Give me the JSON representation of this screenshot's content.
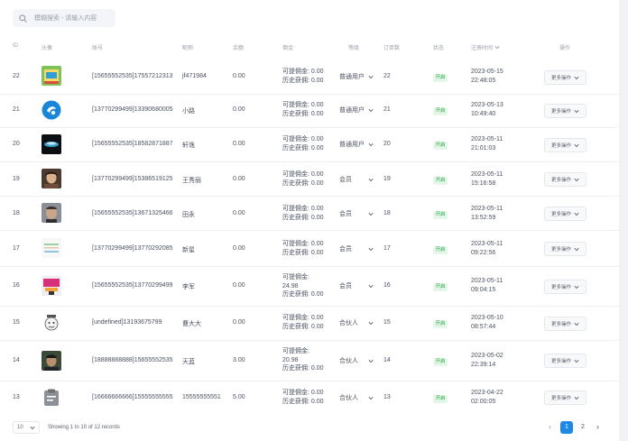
{
  "search": {
    "placeholder": "模糊搜索 - 请输入内容"
  },
  "columns": {
    "id": "ID",
    "avatar": "头像",
    "account": "账号",
    "nickname": "昵称",
    "balance": "余额",
    "commission": "佣金",
    "level": "等级",
    "orders": "订单数",
    "status": "状态",
    "register_time": "注册时间",
    "actions": "操作"
  },
  "rows": [
    {
      "id": "22",
      "account": "[15655552535]17557212313",
      "nickname": "jf471984",
      "balance": "0.00",
      "withdrawable": "可提佣金:  0.00",
      "history": "历史获佣:  0.00",
      "level": "普通用户",
      "orders": "22",
      "status": "开启",
      "date": "2023-05-15",
      "time": "22:48:05",
      "more": "更多操作"
    },
    {
      "id": "21",
      "account": "[13770299499]13390680005",
      "nickname": "小路",
      "balance": "0.00",
      "withdrawable": "可提佣金:  0.00",
      "history": "历史获佣:  0.00",
      "level": "普通用户",
      "orders": "21",
      "status": "开启",
      "date": "2023-05-13",
      "time": "10:49:40",
      "more": "更多操作"
    },
    {
      "id": "20",
      "account": "[15655552535]18582871887",
      "nickname": "轩逸",
      "balance": "0.00",
      "withdrawable": "可提佣金:  0.00",
      "history": "历史获佣:  0.00",
      "level": "普通用户",
      "orders": "20",
      "status": "开启",
      "date": "2023-05-11",
      "time": "21:01:03",
      "more": "更多操作"
    },
    {
      "id": "19",
      "account": "[13770299499]15386519125",
      "nickname": "王秀丽",
      "balance": "0.00",
      "withdrawable": "可提佣金:  0.00",
      "history": "历史获佣:  0.00",
      "level": "会员",
      "orders": "19",
      "status": "开启",
      "date": "2023-05-11",
      "time": "15:16:58",
      "more": "更多操作"
    },
    {
      "id": "18",
      "account": "[15655552535]13671325466",
      "nickname": "田永",
      "balance": "0.00",
      "withdrawable": "可提佣金:  0.00",
      "history": "历史获佣:  0.00",
      "level": "会员",
      "orders": "18",
      "status": "开启",
      "date": "2023-05-11",
      "time": "13:52:59",
      "more": "更多操作"
    },
    {
      "id": "17",
      "account": "[13770299499]13770292085",
      "nickname": "新星",
      "balance": "0.00",
      "withdrawable": "可提佣金:  0.00",
      "history": "历史获佣:  0.00",
      "level": "会员",
      "orders": "17",
      "status": "开启",
      "date": "2023-05-11",
      "time": "09:22:56",
      "more": "更多操作"
    },
    {
      "id": "16",
      "account": "[15655552535]13770299499",
      "nickname": "李军",
      "balance": "0.00",
      "withdrawable": "可提佣金:",
      "withdrawable_value": "24.98",
      "history": "历史获佣:  0.00",
      "level": "会员",
      "orders": "16",
      "status": "开启",
      "date": "2023-05-11",
      "time": "09:04:15",
      "more": "更多操作"
    },
    {
      "id": "15",
      "account": "[undefined]13193675799",
      "nickname": "曹大大",
      "balance": "0.00",
      "withdrawable": "可提佣金:  0.00",
      "history": "历史获佣:  0.00",
      "level": "合伙人",
      "orders": "15",
      "status": "开启",
      "date": "2023-05-10",
      "time": "08:57:44",
      "more": "更多操作"
    },
    {
      "id": "14",
      "account": "[18888888888]15655552535",
      "nickname": "天蓝",
      "balance": "3.00",
      "withdrawable": "可提佣金:",
      "withdrawable_value": "20.98",
      "history": "历史获佣:  0.00",
      "level": "合伙人",
      "orders": "14",
      "status": "开启",
      "date": "2023-05-02",
      "time": "22:39:14",
      "more": "更多操作"
    },
    {
      "id": "13",
      "account": "[16666666666]15555555555",
      "nickname": "15555555551",
      "balance": "5.00",
      "withdrawable": "可提佣金:  0.00",
      "history": "历史获佣:  0.00",
      "level": "合伙人",
      "orders": "13",
      "status": "开启",
      "date": "2023-04-22",
      "time": "02:00:05",
      "more": "更多操作"
    }
  ],
  "footer": {
    "page_size": "10",
    "info": "Showing 1 to 10 of 12 records",
    "pages": [
      "1",
      "2"
    ],
    "prev": "‹",
    "next": "›"
  },
  "colors": {
    "accent": "#1e88e5",
    "status_green": "#28a745",
    "status_bg": "#e6f7ea"
  }
}
